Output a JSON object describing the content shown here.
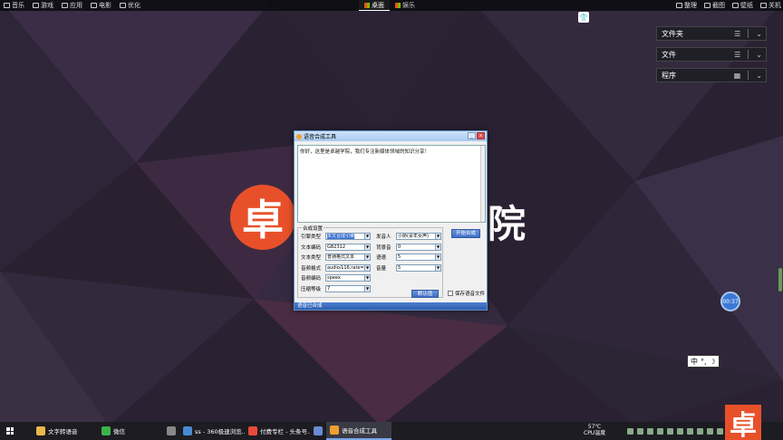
{
  "topbar": {
    "left_items": [
      {
        "label": "音乐",
        "icon": "music-icon"
      },
      {
        "label": "游戏",
        "icon": "gamepad-icon"
      },
      {
        "label": "应用",
        "icon": "apps-icon"
      },
      {
        "label": "电影",
        "icon": "film-icon"
      },
      {
        "label": "优化",
        "icon": "rocket-icon"
      }
    ],
    "tabs": [
      {
        "label": "桌面",
        "active": true
      },
      {
        "label": "娱乐",
        "active": false
      }
    ],
    "right_items": [
      {
        "label": "整理",
        "icon": "organize-icon"
      },
      {
        "label": "截图",
        "icon": "screenshot-icon"
      },
      {
        "label": "壁纸",
        "icon": "wallpaper-icon"
      },
      {
        "label": "关机",
        "icon": "power-icon"
      }
    ]
  },
  "fences": [
    {
      "label": "文件夹"
    },
    {
      "label": "文件"
    },
    {
      "label": "程序"
    }
  ],
  "logo": {
    "char": "卓",
    "text": "院"
  },
  "dialog": {
    "title": "语音合成工具",
    "text": "你好，这里是卓越学院，我们专注新媒体领域的知识分享！",
    "settings_title": "合成设置",
    "left_fields": [
      {
        "label": "引擎类型",
        "value": "本文合成引擎",
        "selected": true
      },
      {
        "label": "文本编码",
        "value": "GB2312",
        "selected": false
      },
      {
        "label": "文本类型",
        "value": "普通格式文本",
        "selected": false
      },
      {
        "label": "音频格式",
        "value": "audio/L16;rate=",
        "selected": false
      },
      {
        "label": "音频编码",
        "value": "speex",
        "selected": false
      },
      {
        "label": "压缩等级",
        "value": "7",
        "selected": false
      }
    ],
    "right_fields": [
      {
        "label": "发音人",
        "value": "小娇(青年女声)"
      },
      {
        "label": "背景音",
        "value": "0"
      },
      {
        "label": "语速",
        "value": "5"
      },
      {
        "label": "音量",
        "value": "5"
      }
    ],
    "start_button": "开始合成",
    "default_button": "默认值",
    "save_checkbox": "保存语音文件",
    "status": "语音已合成"
  },
  "float_ball": "00:37",
  "ime": {
    "lang": "中"
  },
  "taskbar": {
    "items": [
      {
        "label": "文字转语音",
        "color": "#e8b84a",
        "active": false
      },
      {
        "label": "微信",
        "color": "#3cb34a",
        "active": false
      },
      {
        "label": "",
        "color": "#888",
        "active": false
      },
      {
        "label": "ss - 360极速浏览...",
        "color": "#4a8ad4",
        "active": false
      },
      {
        "label": "付费专栏 - 头条号...",
        "color": "#e84a3a",
        "active": false
      },
      {
        "label": "",
        "color": "#6a8ad4",
        "active": false
      },
      {
        "label": "语音合成工具",
        "color": "#f0a030",
        "active": true
      }
    ],
    "temp": "57℃",
    "temp_label": "CPU温度"
  },
  "corner_logo": "卓"
}
